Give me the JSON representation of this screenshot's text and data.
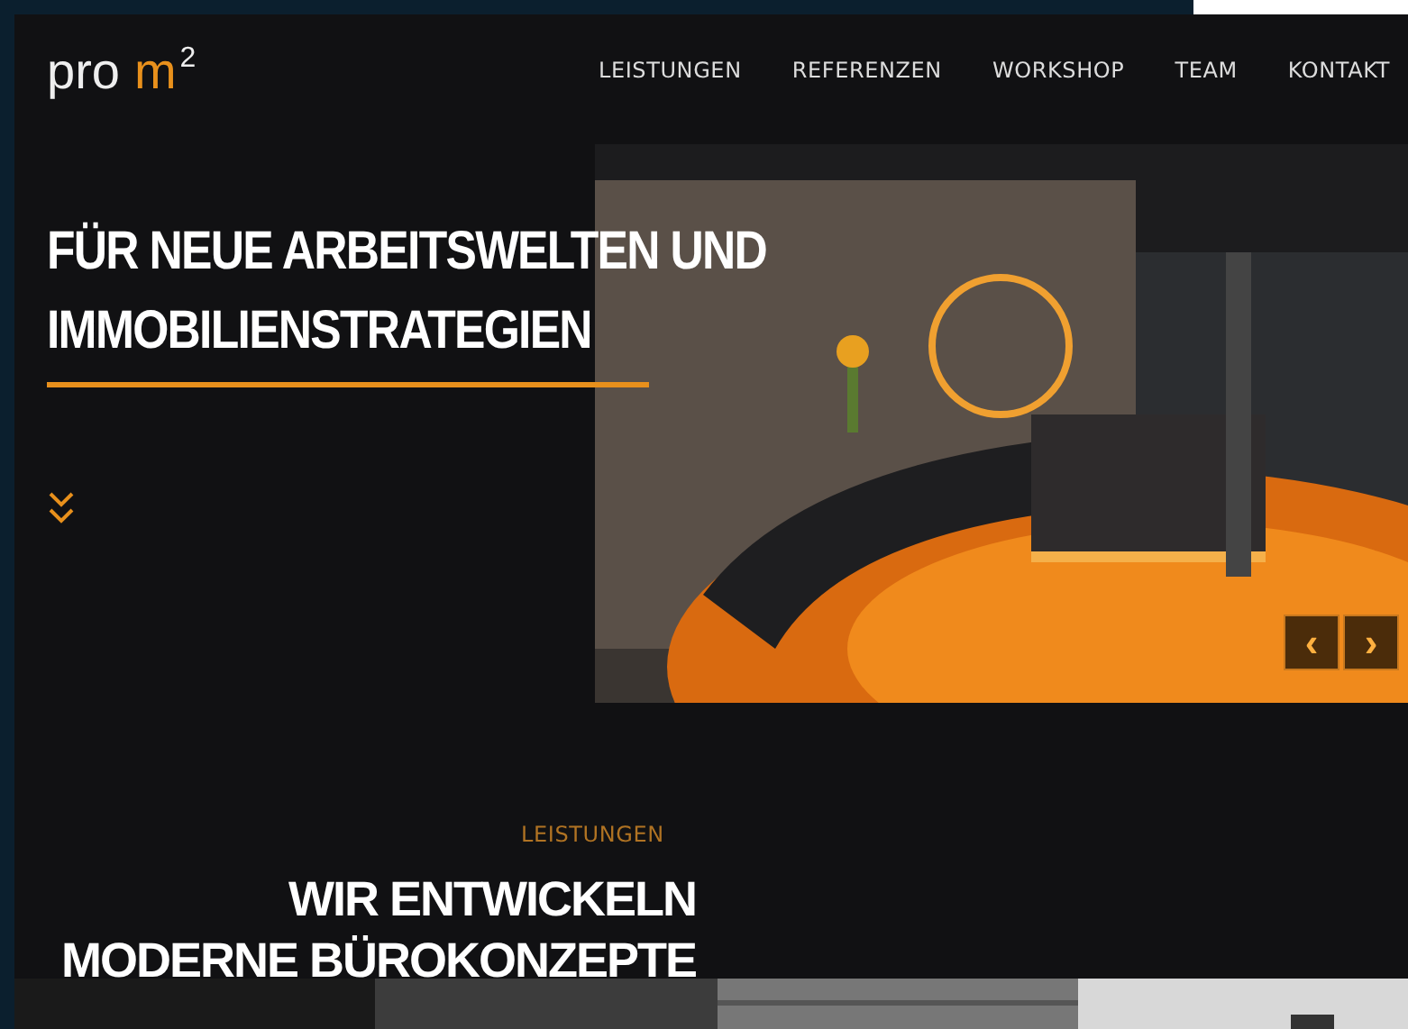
{
  "logo": {
    "prefix": "pro",
    "highlight": "m",
    "superscript": "2"
  },
  "nav": [
    {
      "label": "LEISTUNGEN"
    },
    {
      "label": "REFERENZEN"
    },
    {
      "label": "WORKSHOP"
    },
    {
      "label": "TEAM"
    },
    {
      "label": "KONTAKT"
    }
  ],
  "hero": {
    "title_lines": [
      "FÜR NEUE ARBEITSWELTEN UND",
      "IMMOBILIENSTRATEGIEN"
    ],
    "slider_buttons": [
      {
        "glyph": "‹"
      },
      {
        "glyph": "›"
      }
    ]
  },
  "section": {
    "eyebrow": "LEISTUNGEN",
    "heading_lines": [
      "WIR ENTWICKELN",
      "MODERNE BÜROKONZEPTE"
    ]
  }
}
